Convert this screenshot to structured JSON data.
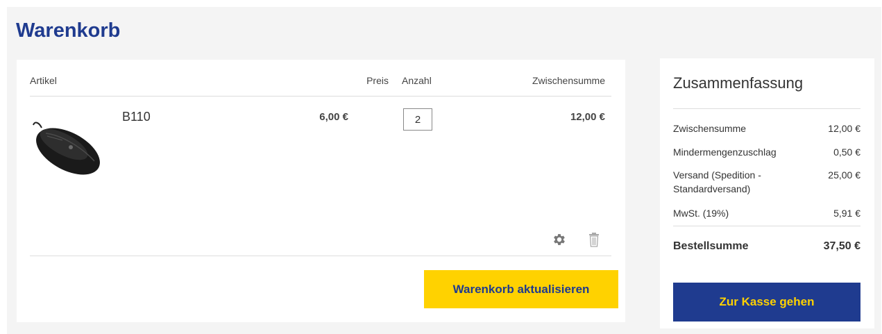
{
  "page": {
    "title": "Warenkorb"
  },
  "cart": {
    "headers": {
      "article": "Artikel",
      "price": "Preis",
      "quantity": "Anzahl",
      "subtotal": "Zwischensumme"
    },
    "items": [
      {
        "name": "B110",
        "price": "6,00 €",
        "quantity": "2",
        "subtotal": "12,00 €",
        "image_icon": "computer-mouse-image",
        "actions": [
          "gear-icon",
          "trash-icon"
        ]
      }
    ],
    "update_label": "Warenkorb aktualisieren"
  },
  "summary": {
    "title": "Zusammenfassung",
    "rows": [
      {
        "label": "Zwischensumme",
        "value": "12,00 €"
      },
      {
        "label": "Mindermengenzuschlag",
        "value": "0,50 €"
      },
      {
        "label": "Versand (Spedition - Standardversand)",
        "value": "25,00 €"
      },
      {
        "label": "MwSt. (19%)",
        "value": "5,91 €"
      }
    ],
    "total": {
      "label": "Bestellsumme",
      "value": "37,50 €"
    },
    "checkout_label": "Zur Kasse gehen"
  },
  "colors": {
    "brand_blue": "#1f3b8f",
    "brand_yellow": "#ffd200",
    "background": "#f4f4f4"
  }
}
